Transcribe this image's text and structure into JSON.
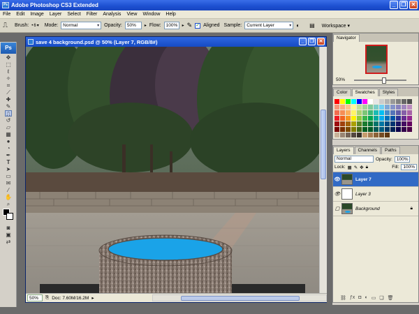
{
  "app": {
    "title": "Adobe Photoshop CS3 Extended",
    "logo": "Ps",
    "win_minimize": "_",
    "win_restore": "❐",
    "win_close": "✕"
  },
  "menu": [
    "File",
    "Edit",
    "Image",
    "Layer",
    "Select",
    "Filter",
    "Analysis",
    "View",
    "Window",
    "Help"
  ],
  "options": {
    "brush_label": "Brush:",
    "brush_size": "6",
    "mode_label": "Mode:",
    "mode_value": "Normal",
    "opacity_label": "Opacity:",
    "opacity_value": "50%",
    "flow_label": "Flow:",
    "flow_value": "100%",
    "aligned_label": "Aligned",
    "aligned_checked": true,
    "sample_label": "Sample:",
    "sample_value": "Current Layer",
    "workspace_label": "Workspace ▾"
  },
  "document": {
    "title": "save 4 background.psd @ 50% (Layer 7, RGB/8#)",
    "zoom": "50%",
    "doc_info": "Doc: 7.60M/16.2M"
  },
  "navigator": {
    "tab": "Navigator",
    "zoom": "50%"
  },
  "swatches_panel": {
    "tabs": [
      "Color",
      "Swatches",
      "Styles"
    ],
    "active_tab": "Swatches",
    "colors": [
      "#ff0000",
      "#ffff00",
      "#00ff00",
      "#00ffff",
      "#0000ff",
      "#ff00ff",
      "#ffffff",
      "#e6e6e6",
      "#cccccc",
      "#b3b3b3",
      "#999999",
      "#808080",
      "#666666",
      "#4d4d4d",
      "#f7977a",
      "#f9ad81",
      "#fdc68a",
      "#fff79a",
      "#c4df9b",
      "#a2d39c",
      "#82ca9d",
      "#7bcdc8",
      "#6ecff6",
      "#7ea7d8",
      "#8493ca",
      "#8882be",
      "#a187be",
      "#bc8dbf",
      "#f26c4f",
      "#f68e55",
      "#fbaf5c",
      "#fff467",
      "#acd372",
      "#7cc576",
      "#3bb878",
      "#1abbb4",
      "#00bff3",
      "#438cca",
      "#5574b9",
      "#605ca8",
      "#855fa8",
      "#a763a8",
      "#ed1c24",
      "#f26522",
      "#f7941d",
      "#fff200",
      "#8dc73f",
      "#39b54a",
      "#00a651",
      "#00a99d",
      "#00aeef",
      "#0072bc",
      "#0054a6",
      "#2e3192",
      "#662d91",
      "#92278f",
      "#9e0b0f",
      "#a0410d",
      "#a36209",
      "#aba000",
      "#598527",
      "#1a7b30",
      "#007236",
      "#00746b",
      "#0076a3",
      "#004b80",
      "#003471",
      "#1b1464",
      "#440e62",
      "#630460",
      "#790000",
      "#7b2e00",
      "#7d4900",
      "#827b00",
      "#406618",
      "#005e20",
      "#005826",
      "#005952",
      "#005b7f",
      "#003663",
      "#002157",
      "#0d004c",
      "#32004b",
      "#4b0049",
      "#c7b299",
      "#998675",
      "#736357",
      "#534741",
      "#37302a",
      "#c69c6d",
      "#a67c52",
      "#8c6239",
      "#754c24",
      "#603913"
    ]
  },
  "layers": {
    "tabs": [
      "Layers",
      "Channels",
      "Paths"
    ],
    "active_tab": "Layers",
    "blend_mode": "Normal",
    "opacity_label": "Opacity:",
    "opacity_value": "100%",
    "lock_label": "Lock:",
    "fill_label": "Fill:",
    "fill_value": "100%",
    "items": [
      {
        "name": "Layer 7",
        "visible": true,
        "selected": true
      },
      {
        "name": "Layer 3",
        "visible": true,
        "selected": false
      },
      {
        "name": "Background",
        "visible": false,
        "selected": false,
        "locked": true
      }
    ]
  },
  "colors": {
    "title_bar": "#1c4fd0",
    "selected_layer": "#316ac5",
    "pool_blue": "#1aa3e8"
  }
}
